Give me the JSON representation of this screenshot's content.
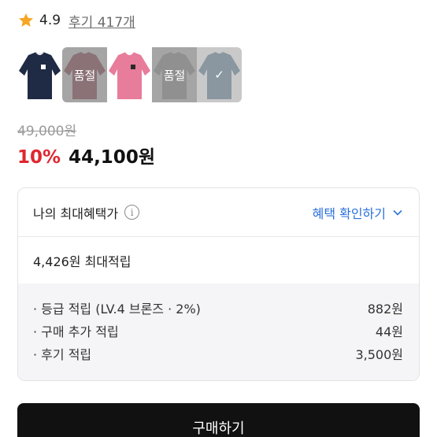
{
  "rating": {
    "score": "4.9",
    "review_link": "후기 417개",
    "star_color": "#f5a623"
  },
  "swatches": [
    {
      "name": "navy",
      "color": "#1f2a44",
      "overlay": "",
      "state": "available"
    },
    {
      "name": "mauve",
      "color": "#a86b78",
      "overlay": "품절",
      "state": "soldout"
    },
    {
      "name": "pink",
      "color": "#e87c9b",
      "overlay": "",
      "state": "available"
    },
    {
      "name": "grey",
      "color": "#b8b8b8",
      "overlay": "품절",
      "state": "soldout"
    },
    {
      "name": "blue-grey",
      "color": "#8fa3b3",
      "overlay": "✓",
      "state": "selected"
    }
  ],
  "price": {
    "original": "49,000원",
    "discount": "10%",
    "final": "44,100원",
    "discount_color": "#e0262f"
  },
  "benefit": {
    "title": "나의 최대혜택가",
    "info_icon": "i",
    "check_link": "혜택 확인하기",
    "max_points": "4,426원 최대적립",
    "details": [
      {
        "label": "· 등급 적립 (LV.4 브론즈 · 2%)",
        "value": "882원"
      },
      {
        "label": "· 구매 추가 적립",
        "value": "44원"
      },
      {
        "label": "· 후기 적립",
        "value": "3,500원"
      }
    ]
  },
  "buy_button": {
    "label": "구매하기"
  },
  "accent_color": "#2a6fdb"
}
